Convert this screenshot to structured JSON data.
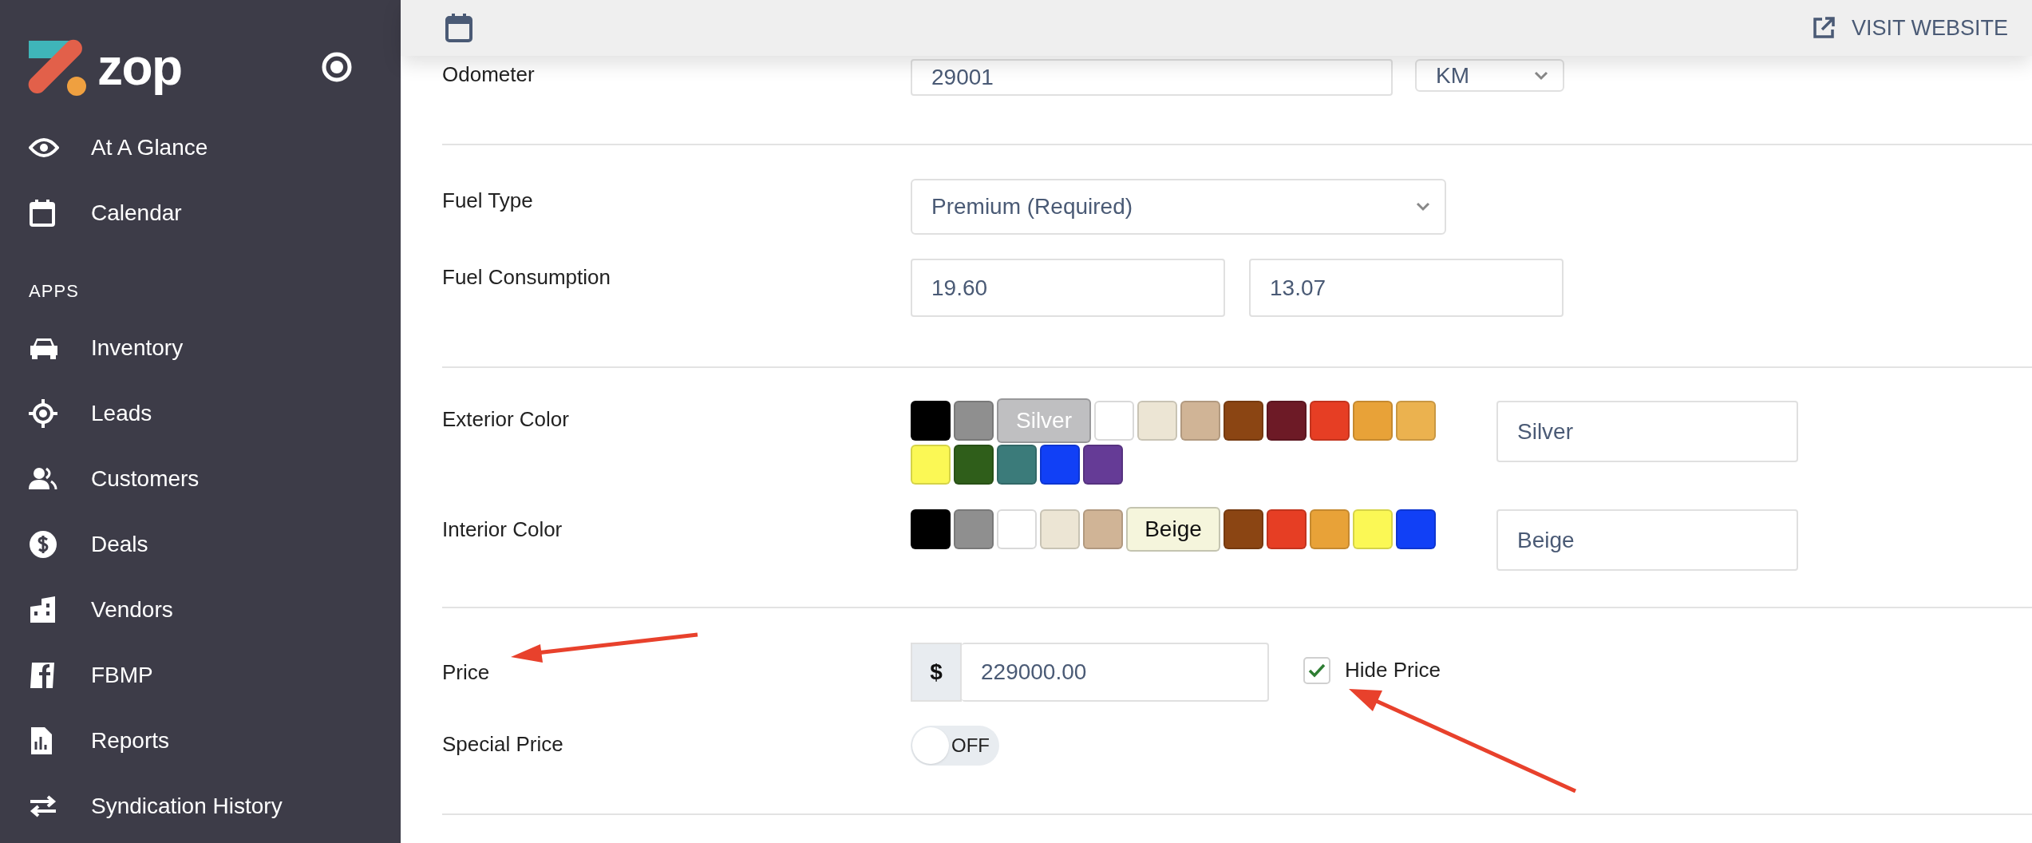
{
  "sidebar": {
    "logo": "zop",
    "items": [
      {
        "label": "At A Glance"
      },
      {
        "label": "Calendar"
      }
    ],
    "section": "APPS",
    "apps": [
      {
        "label": "Inventory"
      },
      {
        "label": "Leads"
      },
      {
        "label": "Customers"
      },
      {
        "label": "Deals"
      },
      {
        "label": "Vendors"
      },
      {
        "label": "FBMP"
      },
      {
        "label": "Reports"
      },
      {
        "label": "Syndication History"
      }
    ]
  },
  "header": {
    "link": "VISIT WEBSITE"
  },
  "odometer": {
    "label": "Odometer",
    "value": "29001",
    "unit": "KM"
  },
  "fuel_type": {
    "label": "Fuel Type",
    "value": "Premium (Required)"
  },
  "fuel_consumption": {
    "label": "Fuel Consumption",
    "values": [
      "19.60",
      "13.07"
    ]
  },
  "exterior_color": {
    "label": "Exterior Color",
    "value": "Silver",
    "swatches": [
      {
        "color": "#000000",
        "selected": false
      },
      {
        "color": "#8f8f8f",
        "selected": false
      },
      {
        "color": "#bfbfc1",
        "selected": true,
        "label": "Silver"
      },
      {
        "color": "#ffffff",
        "selected": false
      },
      {
        "color": "#ece5d4",
        "selected": false
      },
      {
        "color": "#d0b496",
        "selected": false
      },
      {
        "color": "#8b4513",
        "selected": false
      },
      {
        "color": "#6d1a26",
        "selected": false
      },
      {
        "color": "#e63e24",
        "selected": false
      },
      {
        "color": "#e8a238",
        "selected": false
      },
      {
        "color": "#ebb24f",
        "selected": false
      },
      {
        "color": "#fbf855",
        "selected": false
      },
      {
        "color": "#2f5e1a",
        "selected": false
      },
      {
        "color": "#3b7b7a",
        "selected": false
      },
      {
        "color": "#1140f6",
        "selected": false
      },
      {
        "color": "#653b96",
        "selected": false
      }
    ]
  },
  "interior_color": {
    "label": "Interior Color",
    "value": "Beige",
    "swatches": [
      {
        "color": "#000000",
        "selected": false
      },
      {
        "color": "#8f8f8f",
        "selected": false
      },
      {
        "color": "#ffffff",
        "selected": false
      },
      {
        "color": "#ece5d4",
        "selected": false
      },
      {
        "color": "#d0b496",
        "selected": false
      },
      {
        "color": "#f5f5dc",
        "selected": true,
        "label": "Beige"
      },
      {
        "color": "#8b4513",
        "selected": false
      },
      {
        "color": "#e63e24",
        "selected": false
      },
      {
        "color": "#e8a238",
        "selected": false
      },
      {
        "color": "#fbf855",
        "selected": false
      },
      {
        "color": "#1140f6",
        "selected": false
      }
    ]
  },
  "price": {
    "label": "Price",
    "currency": "$",
    "value": "229000.00",
    "hide_price": {
      "label": "Hide Price",
      "checked": true
    }
  },
  "special_price": {
    "label": "Special Price",
    "toggle": {
      "label": "OFF",
      "on": false
    }
  }
}
